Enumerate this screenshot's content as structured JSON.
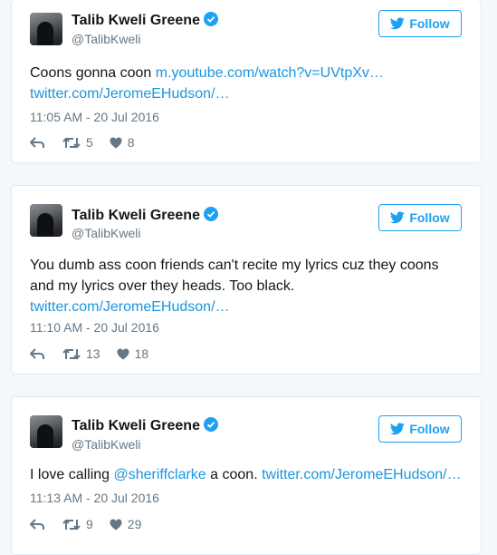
{
  "colors": {
    "link": "#1b95e0",
    "accent": "#1da1f2",
    "muted": "#657786",
    "text": "#14171a"
  },
  "tweets": [
    {
      "name": "Talib Kweli Greene",
      "handle": "@TalibKweli",
      "follow_label": "Follow",
      "text_1": "Coons gonna coon ",
      "link_1": "m.youtube.com/watch?v=UVtpXv…",
      "link_2": "twitter.com/JeromeEHudson/…",
      "time": "11:05 AM - 20 Jul 2016",
      "retweets": "5",
      "likes": "8"
    },
    {
      "name": "Talib Kweli Greene",
      "handle": "@TalibKweli",
      "follow_label": "Follow",
      "text_1": "You dumb ass coon friends can't recite my lyrics cuz they coons",
      "text_2": "and my lyrics over they heads. Too black.",
      "link_1": "twitter.com/JeromeEHudson/…",
      "time": "11:10 AM - 20 Jul 2016",
      "retweets": "13",
      "likes": "18"
    },
    {
      "name": "Talib Kweli Greene",
      "handle": "@TalibKweli",
      "follow_label": "Follow",
      "text_1": "I love calling ",
      "mention": "@sheriffclarke",
      "text_2": " a coon. ",
      "link_1": "twitter.com/JeromeEHudson/…",
      "time": "11:13 AM - 20 Jul 2016",
      "retweets": "9",
      "likes": "29"
    }
  ]
}
